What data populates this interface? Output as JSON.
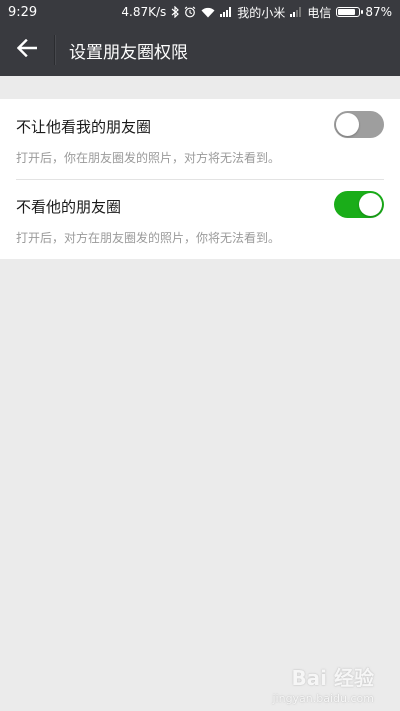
{
  "status_bar": {
    "time": "9:29",
    "net_speed": "4.87K/s",
    "sim1": "我的小米",
    "sim2": "电信",
    "battery": "87%",
    "battery_level": 0.87
  },
  "app_bar": {
    "title": "设置朋友圈权限",
    "back_icon": "arrow-left-icon"
  },
  "settings": [
    {
      "label": "不让他看我的朋友圈",
      "description": "打开后，你在朋友圈发的照片，对方将无法看到。",
      "enabled": false
    },
    {
      "label": "不看他的朋友圈",
      "description": "打开后，对方在朋友圈发的照片，你将无法看到。",
      "enabled": true
    }
  ],
  "colors": {
    "header": "#393a3f",
    "toggle_on": "#1aad19",
    "toggle_off": "#9e9e9e",
    "background": "#ebebeb"
  },
  "watermark": {
    "text": "Bai 经验",
    "sub": "jingyan.baidu.com"
  }
}
